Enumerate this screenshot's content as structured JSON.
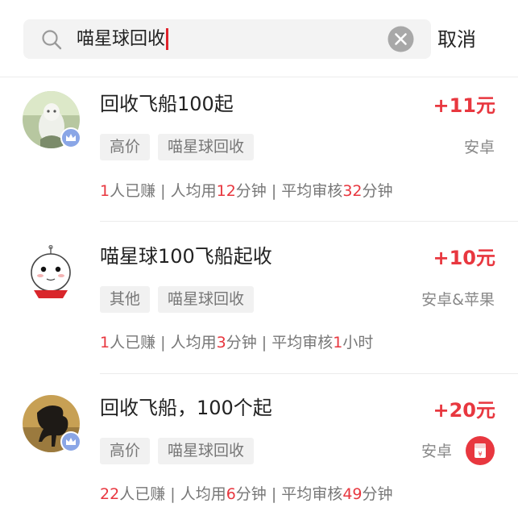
{
  "search": {
    "query": "喵星球回收",
    "cancel_label": "取消"
  },
  "tasks": [
    {
      "title": "回收飞船100起",
      "reward": "+11元",
      "tags": [
        "高价",
        "喵星球回收"
      ],
      "platform": "安卓",
      "stats": {
        "earned_count": "1",
        "earned_label": "人已赚",
        "sep1": " | ",
        "avg_prefix": "人均用",
        "avg_value": "12",
        "avg_unit": "分钟",
        "sep2": " | ",
        "review_prefix": "平均审核",
        "review_value": "32",
        "review_unit": "分钟"
      }
    },
    {
      "title": "喵星球100飞船起收",
      "reward": "+10元",
      "tags": [
        "其他",
        "喵星球回收"
      ],
      "platform": "安卓&苹果",
      "stats": {
        "earned_count": "1",
        "earned_label": "人已赚",
        "sep1": " | ",
        "avg_prefix": "人均用",
        "avg_value": "3",
        "avg_unit": "分钟",
        "sep2": " | ",
        "review_prefix": "平均审核",
        "review_value": "1",
        "review_unit": "小时"
      }
    },
    {
      "title": "回收飞船，100个起",
      "reward": "+20元",
      "tags": [
        "高价",
        "喵星球回收"
      ],
      "platform": "安卓",
      "stats": {
        "earned_count": "22",
        "earned_label": "人已赚",
        "sep1": " | ",
        "avg_prefix": "人均用",
        "avg_value": "6",
        "avg_unit": "分钟",
        "sep2": " | ",
        "review_prefix": "平均审核",
        "review_value": "49",
        "review_unit": "分钟"
      },
      "redpacket_icon": "yen-redpacket-icon",
      "redpacket_symbol": "¥"
    }
  ],
  "colors": {
    "accent": "#e8373f",
    "badge": "#8aa6e6",
    "tag_bg": "#f1f1f1"
  }
}
